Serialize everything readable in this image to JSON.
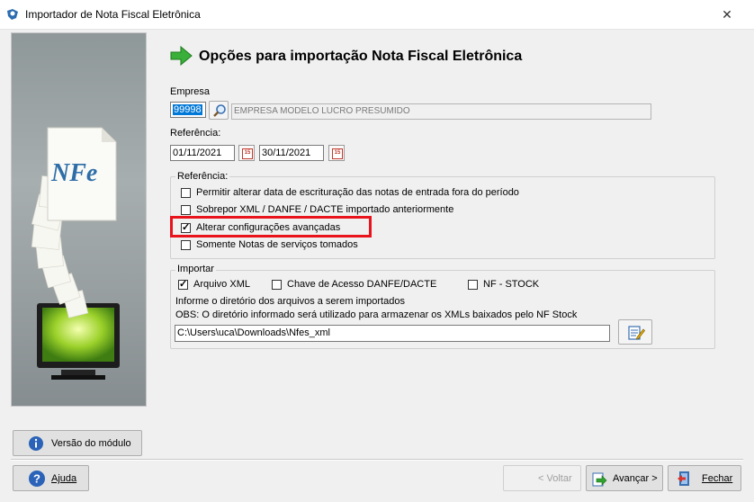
{
  "window": {
    "title": "Importador de Nota Fiscal Eletrônica",
    "close_glyph": "✕"
  },
  "header": {
    "title": "Opções para importação Nota Fiscal Eletrônica"
  },
  "logo": {
    "text": "NFe"
  },
  "empresa": {
    "label": "Empresa",
    "code": "99998",
    "name": "EMPRESA MODELO LUCRO PRESUMIDO"
  },
  "referencia": {
    "label": "Referência:",
    "start": "01/11/2021",
    "end": "30/11/2021",
    "cal_glyph": "15"
  },
  "ref_group": {
    "legend": "Referência:",
    "options": [
      {
        "label": "Permitir alterar data de escrituração das notas de entrada fora do período",
        "checked": false
      },
      {
        "label": "Sobrepor XML / DANFE / DACTE importado anteriormente",
        "checked": false
      },
      {
        "label": "Alterar configurações avançadas",
        "checked": true
      },
      {
        "label": "Somente Notas de serviços tomados",
        "checked": false
      }
    ]
  },
  "importar": {
    "legend": "Importar",
    "options": [
      {
        "label": "Arquivo XML",
        "checked": true
      },
      {
        "label": "Chave de Acesso DANFE/DACTE",
        "checked": false
      },
      {
        "label": "NF - STOCK",
        "checked": false
      }
    ],
    "info": "Informe o diretório dos arquivos a serem importados",
    "obs": "OBS: O diretório informado será utilizado para armazenar os XMLs baixados pelo NF Stock",
    "path": "C:\\Users\\uca\\Downloads\\Nfes_xml"
  },
  "buttons": {
    "versao": "Versão do módulo",
    "ajuda": "Ajuda",
    "voltar": "< Voltar",
    "avancar": "Avançar >",
    "fechar": "Fechar"
  },
  "colors": {
    "highlight": "#e8131b",
    "arrow": "#3ab03a",
    "selection": "#0078d7"
  }
}
